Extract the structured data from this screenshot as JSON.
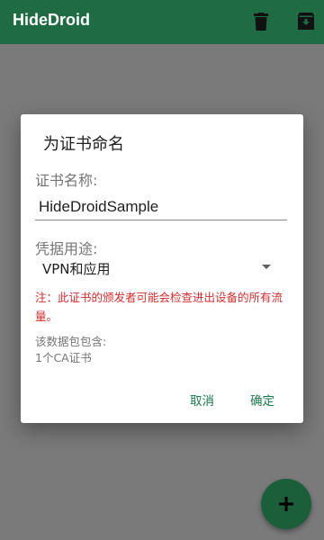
{
  "app": {
    "title": "HideDroid",
    "colors": {
      "primary": "#1f6b43",
      "accent": "#1b5e3a",
      "warning": "#d32f2f"
    }
  },
  "toolbar": {
    "icons": [
      "delete-icon",
      "archive-icon"
    ]
  },
  "dialog": {
    "title": "为证书命名",
    "name_label": "证书名称:",
    "name_value": "HideDroidSample",
    "usage_label": "凭据用途:",
    "usage_value": "VPN和应用",
    "warning": "注：此证书的颁发者可能会检查进出设备的所有流量。",
    "info_title": "该数据包包含:",
    "info_value": "1个CA证书",
    "cancel_label": "取消",
    "ok_label": "确定"
  },
  "fab": {
    "icon": "plus-icon"
  }
}
